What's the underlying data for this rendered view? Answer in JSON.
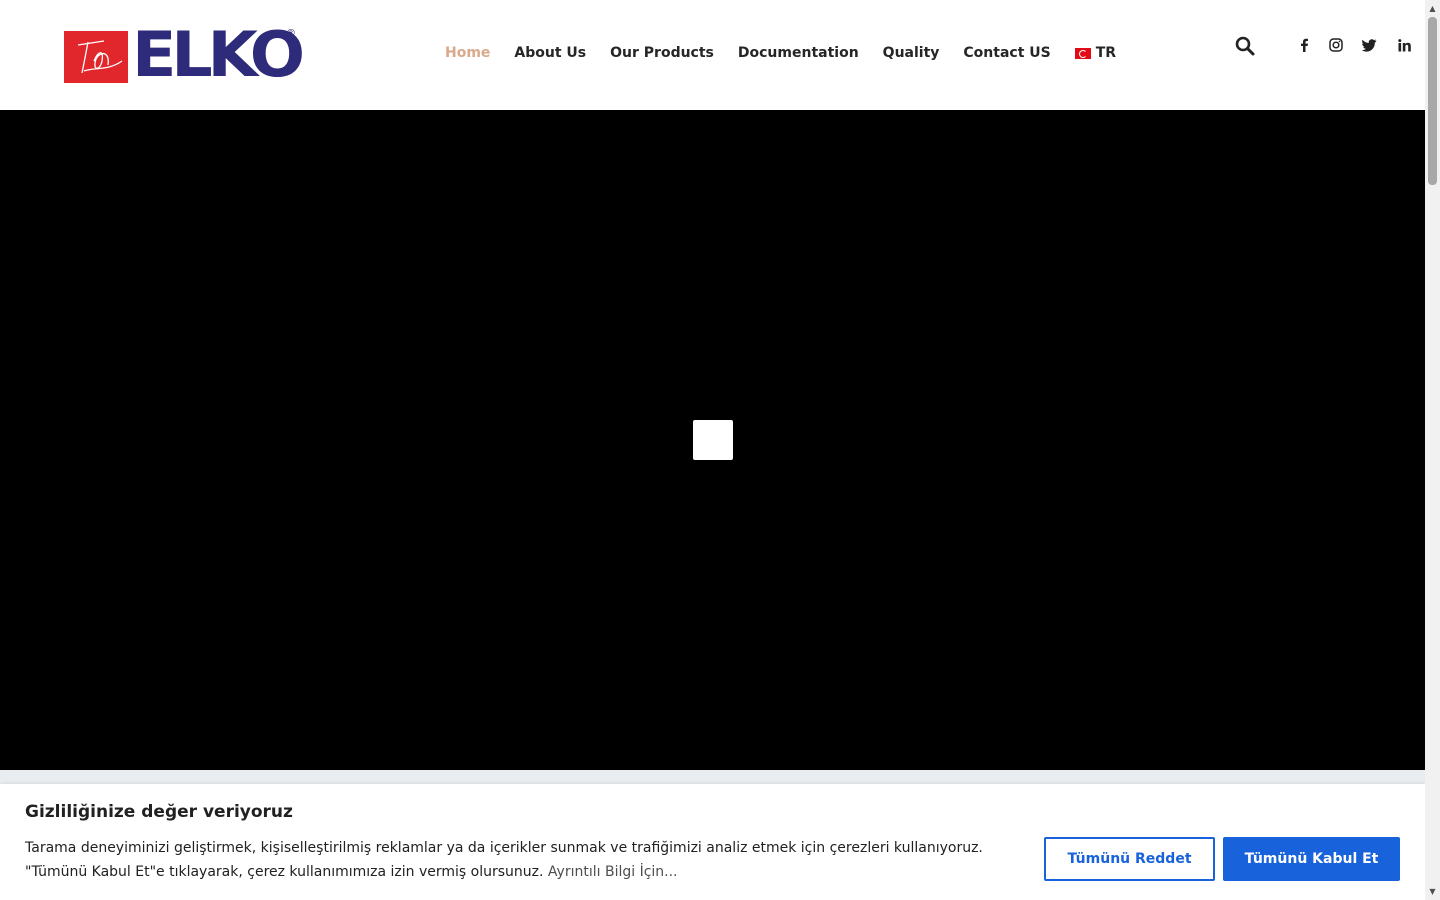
{
  "brand": {
    "logo_text": "ELKO",
    "registered_mark": "®",
    "primary_color": "#2e2b7a",
    "mark_color": "#e1262c"
  },
  "nav": {
    "items": [
      {
        "label": "Home",
        "active": true
      },
      {
        "label": "About Us",
        "active": false
      },
      {
        "label": "Our Products",
        "active": false
      },
      {
        "label": "Documentation",
        "active": false
      },
      {
        "label": "Quality",
        "active": false
      },
      {
        "label": "Contact US",
        "active": false
      }
    ],
    "language": "TR",
    "active_color": "#d9a98a"
  },
  "header_icons": {
    "search": "search-icon",
    "social": [
      "facebook-icon",
      "instagram-icon",
      "twitter-icon",
      "linkedin-icon"
    ]
  },
  "cookie_banner": {
    "title": "Gizliliğinize değer veriyoruz",
    "text": "Tarama deneyiminizi geliştirmek, kişiselleştirilmiş reklamlar ya da içerikler sunmak ve trafiğimizi analiz etmek için çerezleri kullanıyoruz. \"Tümünü Kabul Et\"e tıklayarak, çerez kullanımımıza izin vermiş olursunuz.",
    "link_text": "Ayrıntılı Bilgi İçin...",
    "reject_label": "Tümünü Reddet",
    "accept_label": "Tümünü Kabul Et",
    "button_color": "#1863dc"
  }
}
